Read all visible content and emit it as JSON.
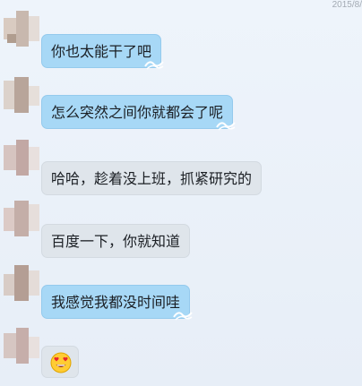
{
  "header": {
    "timestamp": "2015/8/"
  },
  "messages": [
    {
      "text": "你也太能干了吧",
      "style": "blue"
    },
    {
      "text": "怎么突然之间你就都会了呢",
      "style": "blue"
    },
    {
      "text": "哈哈，趁着没上班，抓紧研究的",
      "style": "grey"
    },
    {
      "text": "百度一下，你就知道",
      "style": "grey"
    },
    {
      "text": "我感觉我都没时间哇",
      "style": "blue"
    },
    {
      "text": "",
      "style": "grey",
      "icon": "heart-eyes-emoji-icon"
    }
  ],
  "colors": {
    "bubble_blue": "#a7d8f6",
    "bubble_grey": "#dfe5eb",
    "background": "#eaf1f9"
  }
}
